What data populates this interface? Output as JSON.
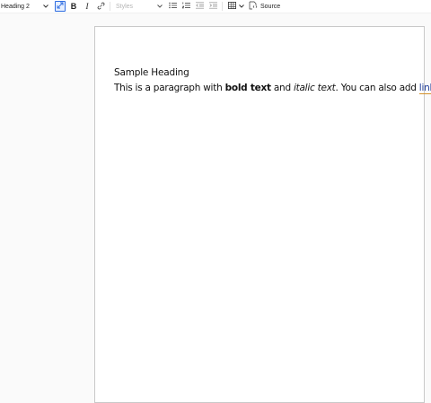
{
  "toolbar": {
    "heading_select": "Heading 2",
    "styles_placeholder": "Styles",
    "source_label": "Source"
  },
  "icons": {
    "dropdown": "chevron-down-icon",
    "link": "link-icon",
    "bullets": "bulleted-list-icon",
    "numbers": "numbered-list-icon",
    "outdent": "outdent-icon",
    "indent": "indent-icon",
    "table": "table-icon",
    "source": "source-icon",
    "fullscreen": "maximize-icon"
  },
  "colors": {
    "active_border": "#2f6de1",
    "link": "#1f3c99",
    "link_underline": "#d4912b"
  },
  "document": {
    "heading": "Sample Heading",
    "para": {
      "p1": "This is a paragraph with ",
      "bold": "bold text",
      "p2": " and ",
      "italic": "italic text",
      "p3": ". You can also add ",
      "link": "links",
      "p4": "."
    }
  }
}
